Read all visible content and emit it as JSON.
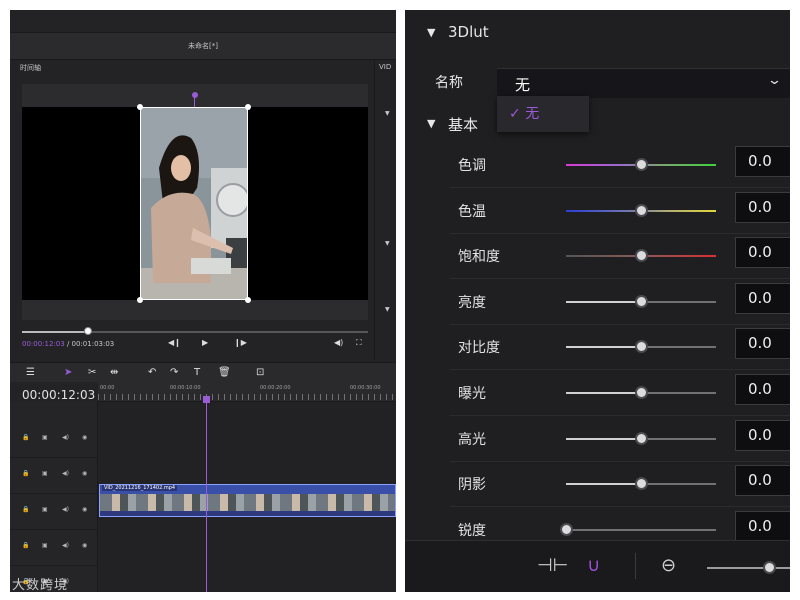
{
  "editor": {
    "project_title": "未命名[*]",
    "timeline_label": "时间轴",
    "side_panel_label": "VID",
    "preview": {
      "current_time": "00:00:12:03",
      "separator": " / ",
      "total_time": "00:01:03:03"
    },
    "timeline": {
      "current_time": "00:00:12:03",
      "ruler_labels": [
        "00:00",
        "00:00:10:00",
        "00:00:20:00",
        "00:00:30:00"
      ],
      "clip_name": "VID_20211216_171402.mp4"
    },
    "icons": {
      "prev_frame": "step-back-icon",
      "play": "play-icon",
      "next_frame": "step-forward-icon",
      "volume": "volume-icon",
      "fullscreen": "fullscreen-icon",
      "lock": "lock-icon",
      "visible": "eye-icon"
    }
  },
  "watermark": "大数跨境",
  "properties": {
    "lut_section": "3Dlut",
    "name_label": "名称",
    "name_value": "无",
    "dropdown_option": "无",
    "basic_section": "基本",
    "params": [
      {
        "label": "色调",
        "value": "0.0",
        "level": 0.5,
        "gradient": "linear-gradient(90deg,#d63cd6,#9a6ad0 35%,#7ba86e 65%,#3fd03f)"
      },
      {
        "label": "色温",
        "value": "0.0",
        "level": 0.5,
        "gradient": "linear-gradient(90deg,#2a3fd6,#6f74b0 40%,#b5b070 70%,#e0d63a)"
      },
      {
        "label": "饱和度",
        "value": "0.0",
        "level": 0.5,
        "gradient": "linear-gradient(90deg,#555,#8a5a5a 50%,#d63030)"
      },
      {
        "label": "亮度",
        "value": "0.0",
        "level": 0.5,
        "gradient": "linear-gradient(90deg,#d0d0d3 0%,#d0d0d3 50%,#707075 50%,#707075 100%)"
      },
      {
        "label": "对比度",
        "value": "0.0",
        "level": 0.5,
        "gradient": "linear-gradient(90deg,#d0d0d3 0%,#d0d0d3 50%,#707075 50%,#707075 100%)"
      },
      {
        "label": "曝光",
        "value": "0.0",
        "level": 0.5,
        "gradient": "linear-gradient(90deg,#d0d0d3 0%,#d0d0d3 50%,#707075 50%,#707075 100%)"
      },
      {
        "label": "高光",
        "value": "0.0",
        "level": 0.5,
        "gradient": "linear-gradient(90deg,#d0d0d3 0%,#d0d0d3 50%,#707075 50%,#707075 100%)"
      },
      {
        "label": "阴影",
        "value": "0.0",
        "level": 0.5,
        "gradient": "linear-gradient(90deg,#d0d0d3 0%,#d0d0d3 50%,#707075 50%,#707075 100%)"
      },
      {
        "label": "锐度",
        "value": "0.0",
        "level": 0.0,
        "gradient": "linear-gradient(90deg,#707075,#707075)"
      }
    ]
  },
  "colors": {
    "accent": "#9a5cd6",
    "panel_bg": "#1f1f22",
    "clip_blue": "#3a4fa8"
  }
}
